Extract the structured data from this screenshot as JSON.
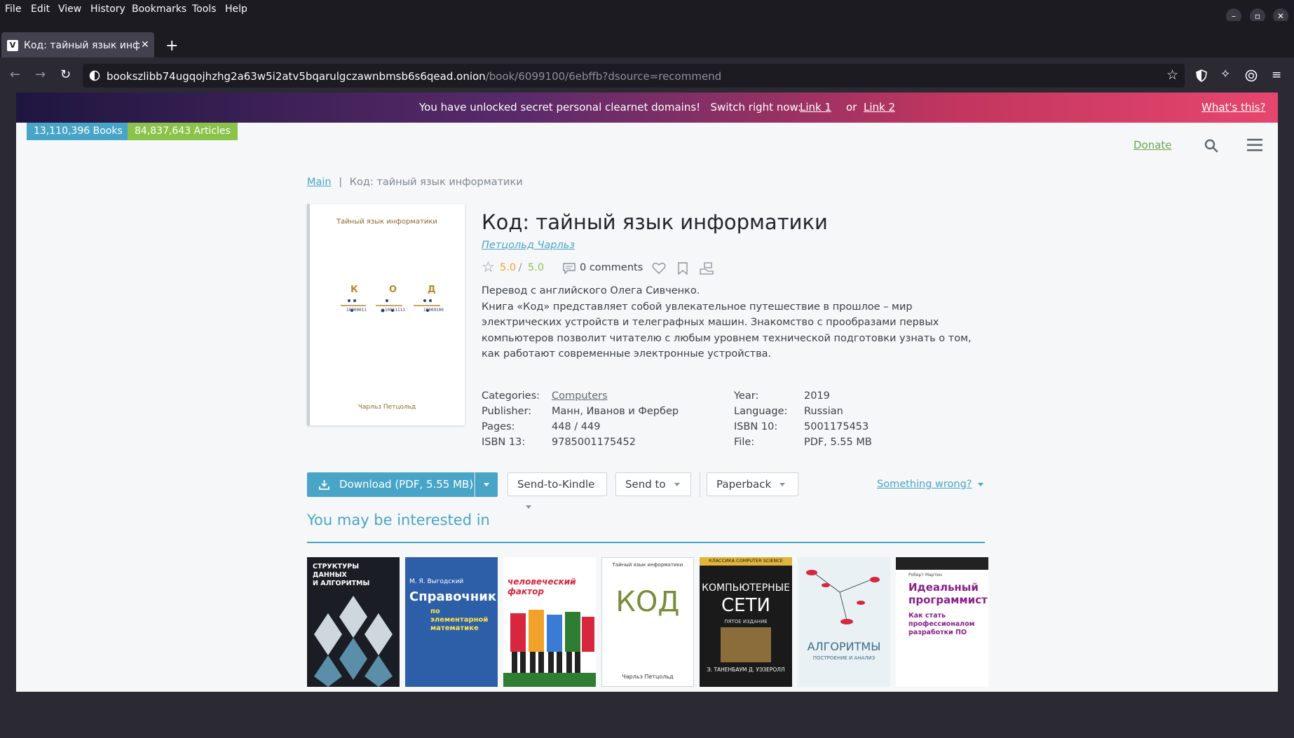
{
  "browser": {
    "menu": [
      "File",
      "Edit",
      "View",
      "History",
      "Bookmarks",
      "Tools",
      "Help"
    ],
    "tab_title": "Код: тайный язык инфор",
    "tab_favicon": "V",
    "url_host": "bookszlibb74ugqojhzhg2a63w5i2atv5bqarulgczawnbmsb6s6qead.onion",
    "url_path": "/book/6099100/6ebffb?dsource=recommend"
  },
  "banner": {
    "text": "You have unlocked secret personal clearnet domains!   Switch right now:",
    "link1": "Link 1",
    "or": "or",
    "link2": "Link 2",
    "whats": "What's this?"
  },
  "stats": {
    "books": "13,110,396 Books",
    "articles": "84,837,643 Articles"
  },
  "header": {
    "donate": "Donate"
  },
  "breadcrumb": {
    "main": "Main",
    "sep": "|",
    "current": "Код: тайный язык информатики"
  },
  "cover_art": {
    "top": "Тайный язык информатики",
    "letters": [
      "К",
      "О",
      "Д"
    ],
    "codes": [
      "10000011",
      "10011111",
      "10000100"
    ],
    "author": "Чарльз Петцольд"
  },
  "book": {
    "title": "Код: тайный язык информатики",
    "author": "Петцольд Чарльз",
    "rating": "5.0",
    "rating_sep": " / ",
    "rating_quality": "5.0",
    "comments": "0 comments",
    "desc1": "Перевод с английского Олега Сивченко.",
    "desc2": "Книга «Код» представляет собой увлекательное путешествие в прошлое – мир электрических устройств и телеграфных машин. Знакомство с прообразами первых компьютеров позволит читателю с любым уровнем технической подготовки узнать о том, как работают современные электронные устройства."
  },
  "props": {
    "categories_label": "Categories:",
    "categories": "Computers",
    "publisher_label": "Publisher:",
    "publisher": "Манн, Иванов и Фербер",
    "pages_label": "Pages:",
    "pages": "448 / 449",
    "isbn13_label": "ISBN 13:",
    "isbn13": "9785001175452",
    "year_label": "Year:",
    "year": "2019",
    "language_label": "Language:",
    "language": "Russian",
    "isbn10_label": "ISBN 10:",
    "isbn10": "5001175453",
    "file_label": "File:",
    "file": "PDF, 5.55 MB"
  },
  "actions": {
    "download": "Download (PDF, 5.55 MB)",
    "kindle": "Send-to-Kindle",
    "sendto": "Send to",
    "paperback": "Paperback",
    "wrong": "Something wrong?"
  },
  "recommend": {
    "heading": "You may be interested in",
    "covers": [
      {
        "line1": "СТРУКТУРЫ ДАННЫХ",
        "line2": "И АЛГОРИТМЫ"
      },
      {
        "line1": "М. Я. Выгодский",
        "line2": "Справочник",
        "line3": "по элементарной математике"
      },
      {
        "line1": "человеческий фактор"
      },
      {
        "line1": "Тайный язык информатики",
        "line2": "КОД",
        "line3": "Чарльз Петцольд"
      },
      {
        "line1": "КЛАССИКА COMPUTER SCIENCE",
        "line2": "КОМПЬЮТЕРНЫЕ",
        "line3": "СЕТИ",
        "line4": "ПЯТОЕ ИЗДАНИЕ",
        "line5": "Э. ТАНЕНБАУМ Д. УЭЗЕРОЛЛ"
      },
      {
        "line1": "АЛГОРИТМЫ",
        "line2": "ПОСТРОЕНИЕ И АНАЛИЗ"
      },
      {
        "line1": "Роберт Мартин",
        "line2": "Идеальный программист",
        "line3": "Как стать профессионалом разработки ПО"
      }
    ]
  },
  "colors": {
    "accent": "#49a5c7",
    "articles_badge": "#8bc34a",
    "rating": "#f5a623"
  }
}
